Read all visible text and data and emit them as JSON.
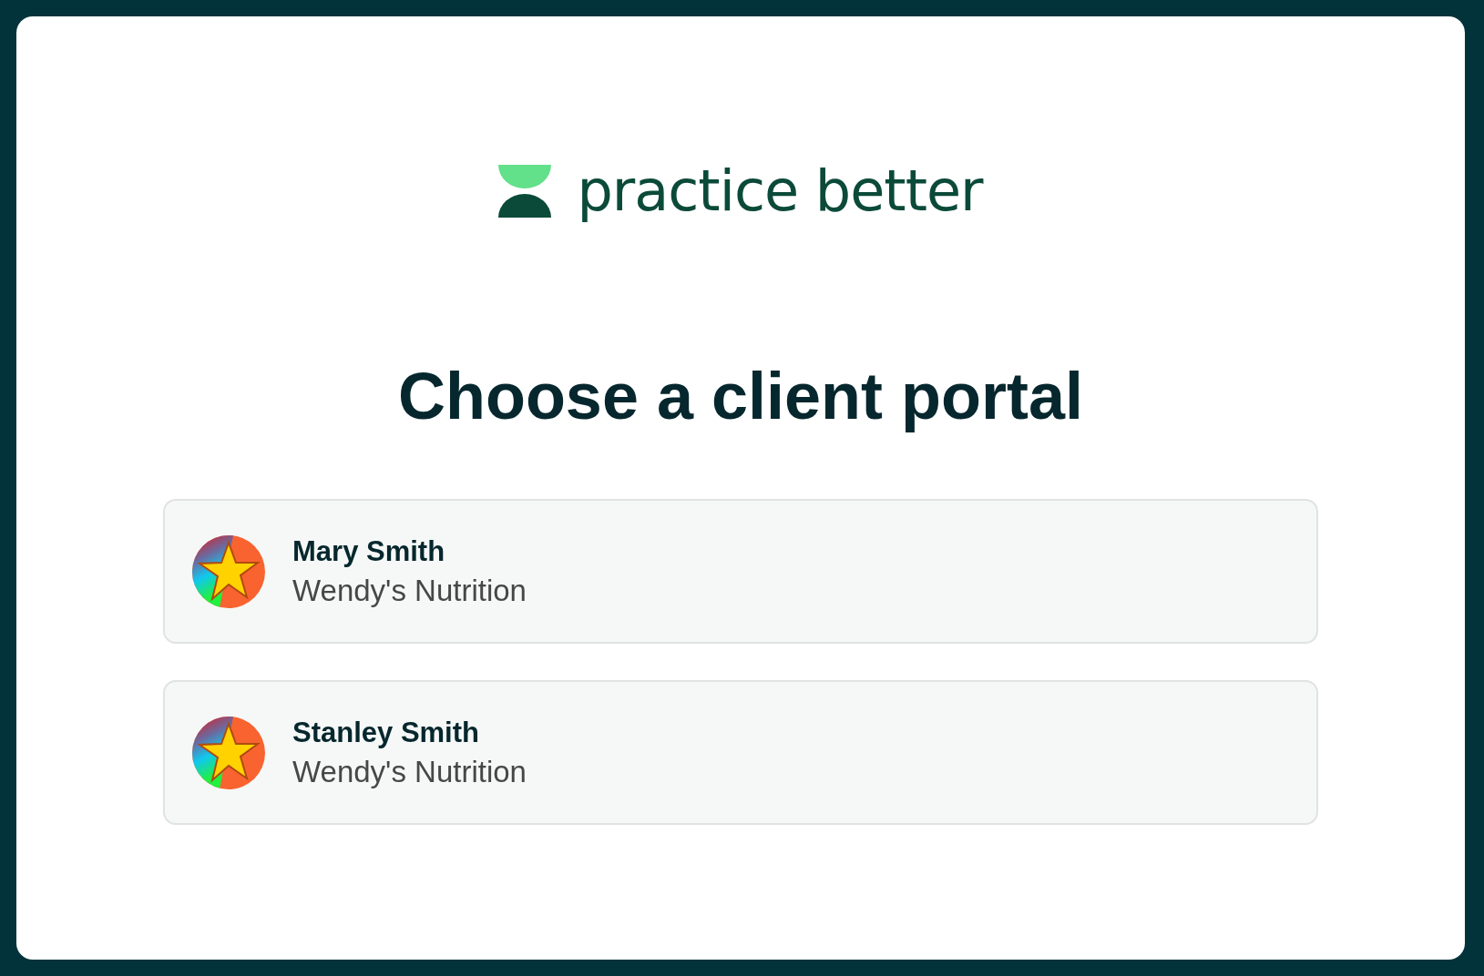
{
  "logo": {
    "wordmark": "practice better"
  },
  "heading": "Choose a client portal",
  "portals": [
    {
      "name": "Mary Smith",
      "practice": "Wendy's Nutrition"
    },
    {
      "name": "Stanley Smith",
      "practice": "Wendy's Nutrition"
    }
  ]
}
